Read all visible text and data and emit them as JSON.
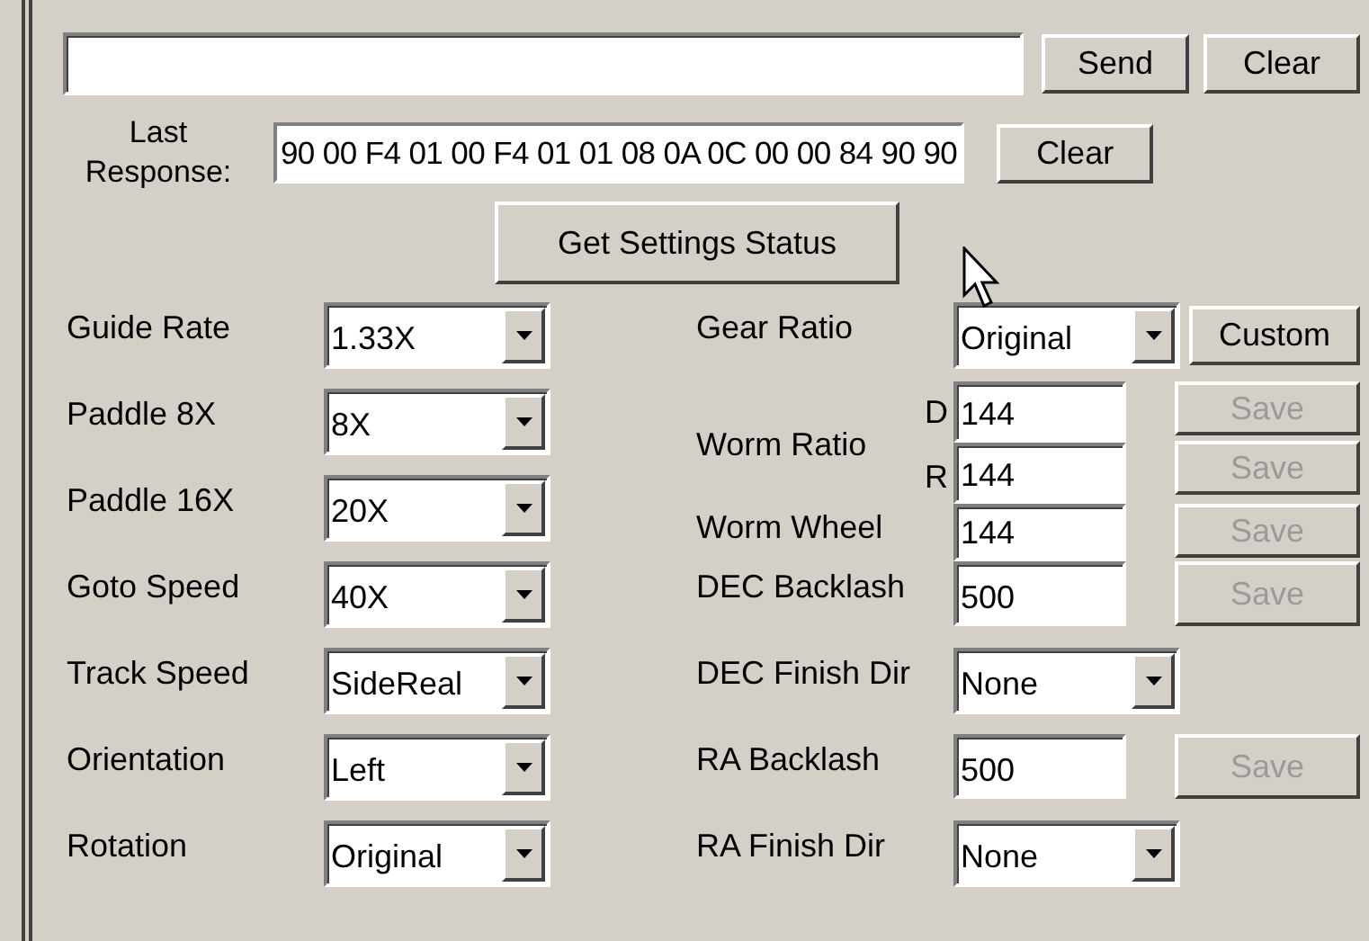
{
  "command": {
    "send_button": "Send",
    "clear_button": "Clear"
  },
  "last_response": {
    "label": "Last Response:",
    "value": "90 00 F4 01 00 F4 01 01 08 0A 0C 00 00 84 90 90",
    "clear_button": "Clear"
  },
  "status_button": "Get Settings Status",
  "left_settings": [
    {
      "label": "Guide Rate",
      "value": "1.33X"
    },
    {
      "label": "Paddle 8X",
      "value": "8X"
    },
    {
      "label": "Paddle 16X",
      "value": "20X"
    },
    {
      "label": "Goto Speed",
      "value": "40X"
    },
    {
      "label": "Track Speed",
      "value": "SideReal"
    },
    {
      "label": "Orientation",
      "value": "Left"
    },
    {
      "label": "Rotation",
      "value": "Original"
    }
  ],
  "right_settings": [
    {
      "kind": "dropdown",
      "label": "Gear Ratio",
      "value": "Original",
      "button": {
        "label": "Custom",
        "disabled": false
      }
    },
    {
      "kind": "pair",
      "label": "Worm Ratio",
      "fields": [
        {
          "sub_label": "D",
          "value": "144",
          "button": {
            "label": "Save",
            "disabled": true
          }
        },
        {
          "sub_label": "R",
          "value": "144",
          "button": {
            "label": "Save",
            "disabled": true
          }
        }
      ]
    },
    {
      "kind": "field",
      "label": "Worm Wheel",
      "value": "144",
      "button": {
        "label": "Save",
        "disabled": true
      }
    },
    {
      "kind": "field",
      "label": "DEC Backlash",
      "value": "500",
      "button": {
        "label": "Save",
        "disabled": true
      }
    },
    {
      "kind": "dropdown",
      "label": "DEC Finish Dir",
      "value": "None"
    },
    {
      "kind": "field",
      "label": "RA Backlash",
      "value": "500",
      "button": {
        "label": "Save",
        "disabled": true
      }
    },
    {
      "kind": "dropdown",
      "label": "RA Finish Dir",
      "value": "None"
    }
  ]
}
